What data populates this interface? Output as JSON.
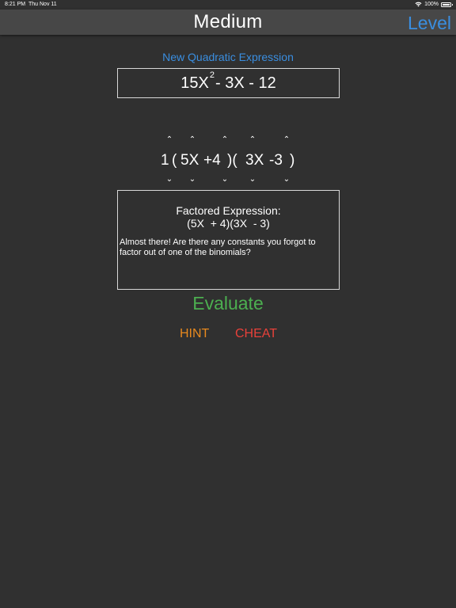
{
  "status_bar": {
    "time": "8:21 PM",
    "date": "Thu Nov 11",
    "battery": "100%"
  },
  "nav": {
    "title": "Medium",
    "level_button": "Level"
  },
  "new_expression_button": "New Quadratic Expression",
  "quadratic": {
    "coef_a": "15X",
    "exponent": "2",
    "rest": "- 3X - 12"
  },
  "factor_row": {
    "gcf": "1",
    "open1": "(",
    "term1a": "5X",
    "term1b": "+4",
    "close_open": ")(",
    "term2a": "3X",
    "term2b": "-3",
    "close2": ")"
  },
  "result": {
    "title": "Factored Expression:",
    "expression": "(5X  + 4)(3X  - 3)",
    "message": "Almost there!  Are there any constants you forgot to factor out of one of the binomials?"
  },
  "evaluate_button": "Evaluate",
  "hint_button": "HINT",
  "cheat_button": "CHEAT",
  "colors": {
    "background": "#303030",
    "nav_background": "#474747",
    "accent_blue": "#3a8ee0",
    "evaluate_green": "#4caf50",
    "hint_orange": "#e8891e",
    "cheat_red": "#e8413a"
  },
  "icons": {
    "increment": "caret-up-icon",
    "decrement": "caret-down-icon",
    "wifi": "wifi-icon",
    "battery": "battery-icon"
  }
}
